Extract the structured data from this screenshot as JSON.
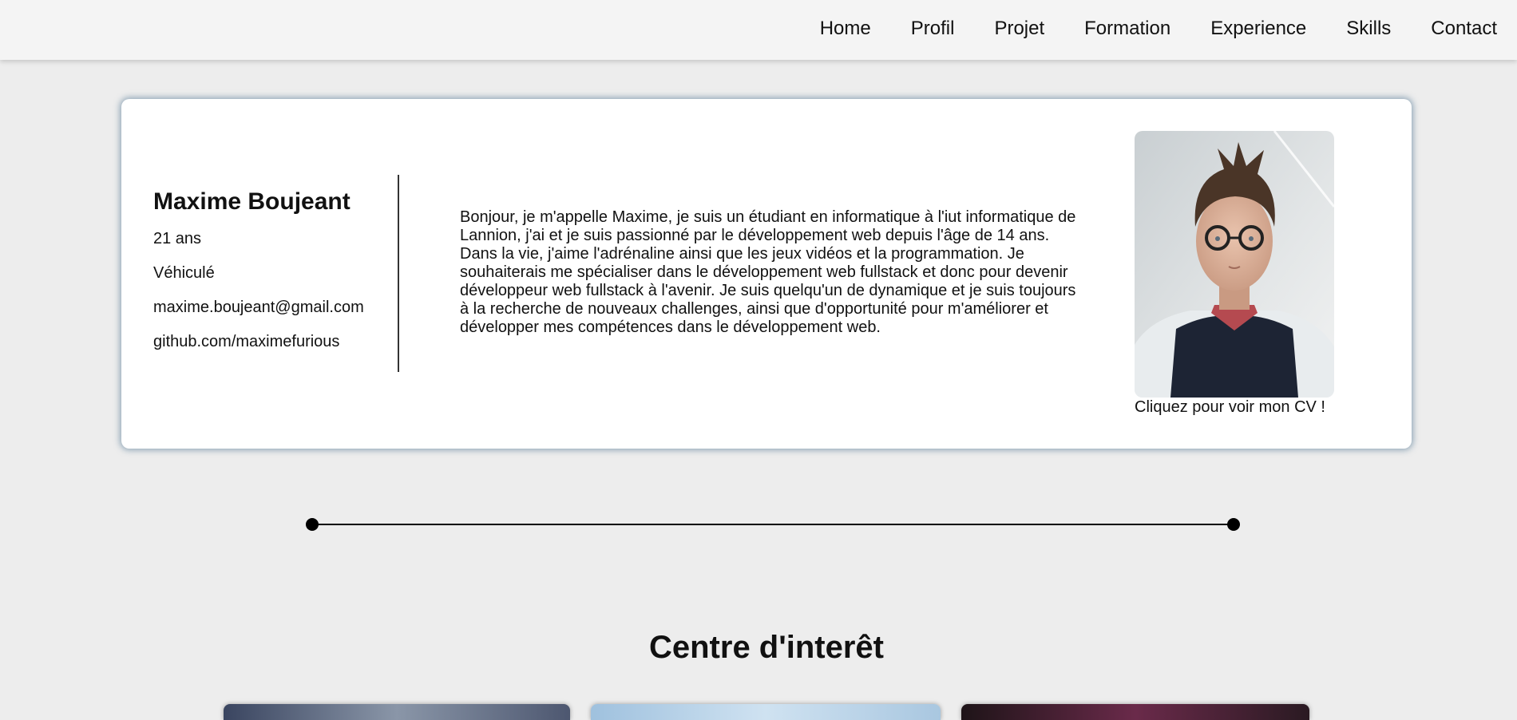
{
  "nav": {
    "items": [
      {
        "label": "Home"
      },
      {
        "label": "Profil"
      },
      {
        "label": "Projet"
      },
      {
        "label": "Formation"
      },
      {
        "label": "Experience"
      },
      {
        "label": "Skills"
      },
      {
        "label": "Contact"
      }
    ]
  },
  "profile": {
    "name": "Maxime Boujeant",
    "age": "21 ans",
    "vehicle": "Véhiculé",
    "email": "maxime.boujeant@gmail.com",
    "github": "github.com/maximefurious",
    "bio": "Bonjour, je m'appelle Maxime, je suis un étudiant en informatique à l'iut informatique de Lannion, j'ai et je suis passionné par le développement web depuis l'âge de 14 ans. Dans la vie, j'aime l'adrénaline ainsi que les jeux vidéos et la programmation. Je souhaiterais me spécialiser dans le développement web fullstack et donc pour devenir développeur web fullstack à l'avenir. Je suis quelqu'un de dynamique et je suis toujours à la recherche de nouveaux challenges, ainsi que d'opportunité pour m'améliorer et développer mes compétences dans le développement web.",
    "photo_caption": "Cliquez pour voir mon CV !"
  },
  "interests": {
    "title": "Centre d'interêt"
  },
  "colors": {
    "background": "#ededed",
    "navbar": "#f4f4f4",
    "card": "#ffffff",
    "card_glow": "#466e8c"
  }
}
